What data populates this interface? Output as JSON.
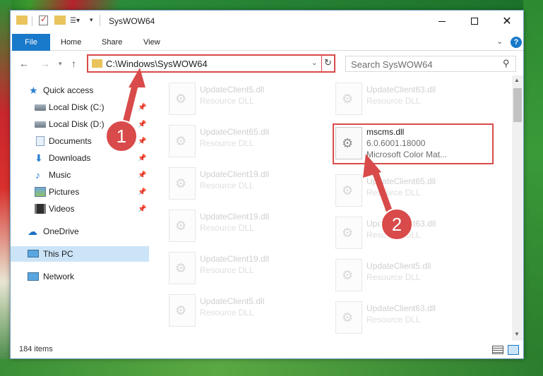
{
  "window": {
    "title": "SysWOW64"
  },
  "ribbon": {
    "tabs": [
      "File",
      "Home",
      "Share",
      "View"
    ]
  },
  "address": {
    "path": "C:\\Windows\\SysWOW64"
  },
  "search": {
    "placeholder": "Search SysWOW64"
  },
  "sidebar": {
    "items": [
      {
        "label": "Quick access",
        "icon": "star-icon"
      },
      {
        "label": "Local Disk (C:)",
        "icon": "disk-icon"
      },
      {
        "label": "Local Disk (D:)",
        "icon": "disk-icon"
      },
      {
        "label": "Documents",
        "icon": "documents-icon"
      },
      {
        "label": "Downloads",
        "icon": "downloads-icon"
      },
      {
        "label": "Music",
        "icon": "music-icon"
      },
      {
        "label": "Pictures",
        "icon": "pictures-icon"
      },
      {
        "label": "Videos",
        "icon": "videos-icon"
      },
      {
        "label": "OneDrive",
        "icon": "cloud-icon"
      },
      {
        "label": "This PC",
        "icon": "pc-icon"
      },
      {
        "label": "Network",
        "icon": "network-icon"
      }
    ]
  },
  "files": {
    "left": [
      {
        "name": "UpdateClient5.dll",
        "desc": "Resource DLL"
      },
      {
        "name": "UpdateClient65.dll",
        "desc": "Resource DLL"
      },
      {
        "name": "UpdateClient19.dll",
        "desc": "Resource DLL"
      },
      {
        "name": "UpdateClient19.dll",
        "desc": "Resource DLL"
      },
      {
        "name": "UpdateClient19.dll",
        "desc": "Resource DLL"
      },
      {
        "name": "UpdateClient5.dll",
        "desc": "Resource DLL"
      }
    ],
    "right": [
      {
        "name": "UpdateClient63.dll",
        "desc": "Resource DLL"
      },
      {
        "name": "UpdateClient65.dll",
        "desc": "Resource DLL"
      },
      {
        "name": "UpdateClient63.dll",
        "desc": "Resource DLL"
      },
      {
        "name": "UpdateClient5.dll",
        "desc": "Resource DLL"
      },
      {
        "name": "UpdateClient63.dll",
        "desc": "Resource DLL"
      }
    ],
    "highlighted": {
      "name": "mscms.dll",
      "version": "6.0.6001.18000",
      "desc": "Microsoft Color Mat..."
    }
  },
  "status": {
    "item_count": "184 items"
  },
  "annotations": {
    "step1": "1",
    "step2": "2",
    "color": "#d94a4a"
  }
}
